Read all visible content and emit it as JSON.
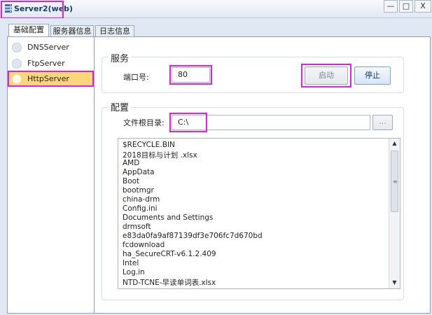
{
  "window": {
    "title": "Server2(web)",
    "icon": "server-app-icon",
    "controls": {
      "minimize": "—",
      "maximize": "□",
      "close": "X"
    }
  },
  "tabs": [
    {
      "label": "基础配置",
      "active": true
    },
    {
      "label": "服务器信息",
      "active": false
    },
    {
      "label": "日志信息",
      "active": false
    }
  ],
  "servers": [
    {
      "label": "DNSServer",
      "selected": false
    },
    {
      "label": "FtpServer",
      "selected": false
    },
    {
      "label": "HttpServer",
      "selected": true
    }
  ],
  "service_group": {
    "title": "服务",
    "port_label": "端口号:",
    "port_value": "80",
    "start_label": "启动",
    "stop_label": "停止"
  },
  "config_group": {
    "title": "配置",
    "root_dir_label": "文件根目录:",
    "root_dir_value": "C:\\",
    "browse_label": "..."
  },
  "files": [
    "$RECYCLE.BIN",
    "2018目标与计划 .xlsx",
    "AMD",
    "AppData",
    "Boot",
    "bootmgr",
    "china-drm",
    "Config.ini",
    "Documents and Settings",
    "drmsoft",
    "e83da0fa9af87139df3e706fc7d670bd",
    "fcdownload",
    "ha_SecureCRT-v6.1.2.409",
    "Intel",
    "Log.in",
    "NTD-TCNE-早读单词表.xlsx"
  ],
  "colors": {
    "highlight": "#e020e0",
    "selected_bg": "#fcd67a",
    "title_text": "#1a3a6e"
  }
}
